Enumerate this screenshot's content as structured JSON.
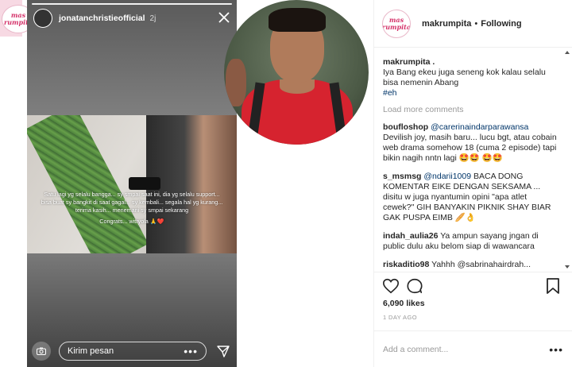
{
  "brand_logo": {
    "line1": "mas",
    "line2": "rumpita"
  },
  "story": {
    "username": "jonatanchristieofficial",
    "time": "2j",
    "caption": "Satu lagi yg selalu bangga... sy smpai saat ini, dia yg selalu support... bisa buat sy bangkit di saat gagal... sy kembali... segala hal yg kurang... terima kasih... menemani sy smpai sekarang",
    "caption_sub": "Congrats... witryola 🙏❤️",
    "message_placeholder": "Kirim pesan",
    "close_icon": "close-icon",
    "send_icon": "send-icon",
    "camera_icon": "camera-icon"
  },
  "post": {
    "header": {
      "username": "makrumpita",
      "separator": "•",
      "follow_status": "Following"
    },
    "caption": {
      "username": "makrumpita .",
      "text": "Iya Bang ekeu juga seneng kok kalau selalu bisa nemenin Abang",
      "hashtag": "#eh"
    },
    "load_more": "Load more comments",
    "comments": [
      {
        "user": "boufloshop",
        "mention": "@carerinaindarparawansa",
        "text": "Devilish joy, masih baru... lucu bgt, atau cobain web drama somehow 18 (cuma 2 episode) tapi bikin nagih nntn lagi 🤩🤩 🤩🤩"
      },
      {
        "user": "s_msmsg",
        "mention": "@ndarii1009",
        "text": "BACA DONG KOMENTAR EIKE DENGAN SEKSAMA ... disitu w juga nyantumin opini \"apa atlet cewek?\" GIH BANYAKIN PIKNIK SHAY BIAR GAK PUSPA EIMB 🥖👌"
      },
      {
        "user": "indah_aulia26",
        "mention": "",
        "text": "Ya ampun sayang jngan di public dulu aku belom siap di wawancara"
      },
      {
        "user": "riskaditio98",
        "mention": "",
        "text": "Yahhh @sabrinahairdrah..."
      }
    ],
    "likes": "6,090 likes",
    "posted": "1 DAY AGO",
    "add_comment_placeholder": "Add a comment...",
    "more_label": "•••"
  },
  "colors": {
    "link": "#003569",
    "muted": "#999999",
    "accent": "#d5346b",
    "shirt": "#d6232f"
  }
}
